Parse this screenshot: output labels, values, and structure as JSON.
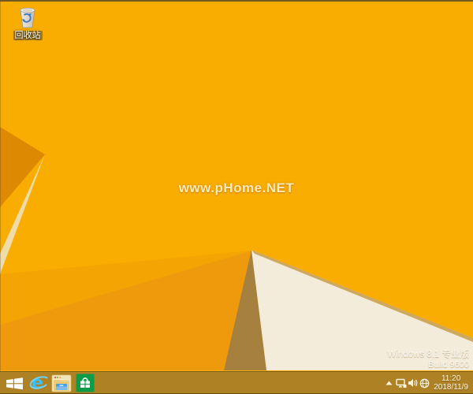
{
  "desktop": {
    "recycle_bin_label": "回收站",
    "center_watermark": "www.pHome.NET"
  },
  "os_watermark": {
    "line1": "Windows 8.1 专业版",
    "line2": "Build 9600"
  },
  "taskbar": {
    "buttons": [
      {
        "name": "start",
        "icon": "windows-logo-icon"
      },
      {
        "name": "internet-explorer",
        "icon": "internet-explorer-icon"
      },
      {
        "name": "file-explorer",
        "icon": "file-explorer-icon"
      },
      {
        "name": "windows-store",
        "icon": "windows-store-icon"
      }
    ],
    "tray": {
      "icons": [
        "show-hidden-icons-chevron",
        "network-icon",
        "volume-icon",
        "ime-globe-icon"
      ],
      "time": "11:20",
      "date": "2018/11/9"
    }
  },
  "icons": {
    "ie_glyph": "e"
  },
  "colors": {
    "wallpaper_main": "#F8AD00",
    "wallpaper_dark_fold": "#DD8A02",
    "wallpaper_cream_fold": "#F0DCA8",
    "wallpaper_facet_a": "#F4A403",
    "wallpaper_facet_b": "#EF9A0D",
    "wallpaper_tan_wedge": "#A5803E",
    "wallpaper_white_panel": "#F4ECDB",
    "wallpaper_fold_shadow": "#C19133",
    "taskbar_tint": "rgba(125,100,62,0.60)",
    "store_green": "#0E9C49",
    "ie_blue": "#3FBFF0"
  }
}
